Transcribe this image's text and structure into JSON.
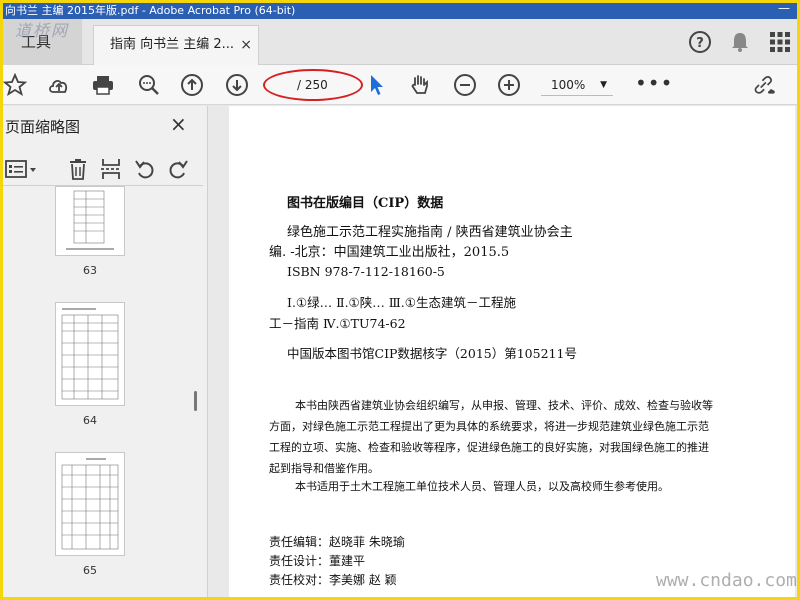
{
  "window": {
    "title": "向书兰 主编 2015年版.pdf - Adobe Acrobat Pro (64-bit)",
    "minimize": "—"
  },
  "tabs": {
    "tools_label": "工具",
    "doc_tab_label": "指南 向书兰 主编 2...",
    "close_glyph": "×"
  },
  "toolbar": {
    "page_total": "/ 250",
    "page_current": "",
    "zoom": "100%",
    "more": "•••"
  },
  "sidebar": {
    "title": "页面缩略图",
    "close_glyph": "×",
    "thumbnails": [
      {
        "label": "63"
      },
      {
        "label": "64"
      },
      {
        "label": "65"
      }
    ]
  },
  "document": {
    "cip_title": "图书在版编目（CIP）数据",
    "line1": "绿色施工示范工程实施指南 / 陕西省建筑业协会主",
    "line2": "编. -北京：中国建筑工业出版社，2015.5",
    "isbn": "ISBN  978-7-112-18160-5",
    "class1": "Ⅰ.①绿…   Ⅱ.①陕…   Ⅲ.①生态建筑－工程施",
    "class2": "工－指南  Ⅳ.①TU74-62",
    "cip_no": "中国版本图书馆CIP数据核字（2015）第105211号",
    "para": [
      "本书由陕西省建筑业协会组织编写，从申报、管理、技术、评价、成效、检查与验收等",
      "方面，对绿色施工示范工程提出了更为具体的系统要求，将进一步规范建筑业绿色施工示范",
      "工程的立项、实施、检查和验收等程序，促进绿色施工的良好实施，对我国绿色施工的推进",
      "起到指导和借鉴作用。",
      "本书适用于土木工程施工单位技术人员、管理人员，以及高校师生参考使用。"
    ],
    "credits": [
      "责任编辑：赵晓菲    朱晓瑜",
      "责任设计：董建平",
      "责任校对：李美娜    赵    颖"
    ]
  },
  "watermarks": {
    "top": "道桥网",
    "bottom": "www.cndao.com"
  },
  "colors": {
    "title_bar": "#2b5fb4",
    "highlight_oval": "#d52020",
    "select_tool": "#1e6fd9"
  }
}
